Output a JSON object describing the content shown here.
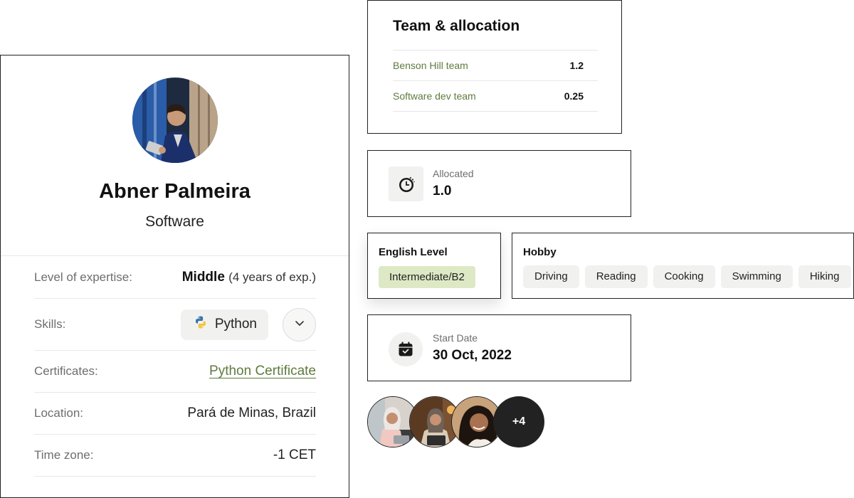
{
  "profile": {
    "name": "Abner Palmeira",
    "role": "Software",
    "rows": {
      "expertise_label": "Level of expertise:",
      "expertise_level": "Middle",
      "expertise_note": "(4 years of exp.)",
      "skills_label": "Skills:",
      "skill": "Python",
      "certificates_label": "Certificates:",
      "certificate": "Python Certificate",
      "location_label": "Location:",
      "location": "Pará de Minas, Brazil",
      "timezone_label": "Time zone:",
      "timezone": "-1 CET"
    }
  },
  "team": {
    "title": "Team & allocation",
    "rows": [
      {
        "name": "Benson Hill team",
        "value": "1.2"
      },
      {
        "name": "Software dev team",
        "value": "0.25"
      }
    ]
  },
  "allocated": {
    "label": "Allocated",
    "value": "1.0",
    "icon": "clock-icon"
  },
  "english": {
    "label": "English Level",
    "level": "Intermediate/B2"
  },
  "hobby": {
    "label": "Hobby",
    "items": [
      "Driving",
      "Reading",
      "Cooking",
      "Swimming",
      "Hiking"
    ]
  },
  "start_date": {
    "label": "Start Date",
    "value": "30 Oct, 2022",
    "icon": "calendar-icon"
  },
  "team_members": {
    "more_label": "+4"
  },
  "colors": {
    "accent_green": "#5f7a3f",
    "chip_green": "#dde9c4",
    "chip_gray": "#f1f1ef",
    "border": "#222222"
  }
}
